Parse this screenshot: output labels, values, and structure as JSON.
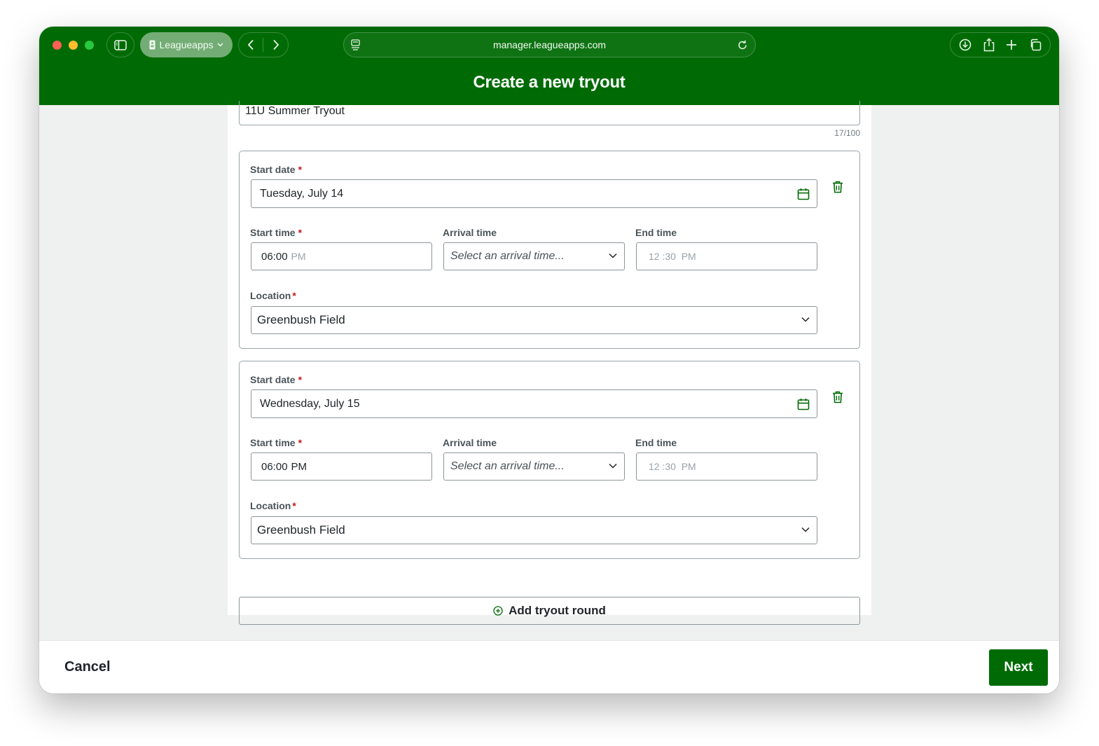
{
  "browser": {
    "profile_label": "Leagueapps",
    "url": "manager.leagueapps.com"
  },
  "page": {
    "title": "Create a new tryout"
  },
  "form": {
    "name_value": "11U Summer Tryout",
    "name_counter": "17/100",
    "rounds": [
      {
        "start_date_label": "Start date",
        "start_date_value": "Tuesday, July 14",
        "start_time_label": "Start time",
        "start_time_value": "06:00",
        "start_time_ampm": "PM",
        "arrival_time_label": "Arrival time",
        "arrival_time_placeholder": "Select an arrival time...",
        "end_time_label": "End time",
        "end_time_value": "12 :30  PM",
        "location_label": "Location",
        "location_value": "Greenbush Field"
      },
      {
        "start_date_label": "Start date",
        "start_date_value": "Wednesday, July 15",
        "start_time_label": "Start time",
        "start_time_value": "06:00",
        "start_time_ampm": "PM",
        "arrival_time_label": "Arrival time",
        "arrival_time_placeholder": "Select an arrival time...",
        "end_time_label": "End time",
        "end_time_value": "12 :30  PM",
        "location_label": "Location",
        "location_value": "Greenbush Field"
      }
    ],
    "required_mark": "*",
    "add_round_label": "Add tryout round"
  },
  "footer": {
    "cancel_label": "Cancel",
    "next_label": "Next"
  },
  "colors": {
    "brand": "#006b05",
    "required": "#c41a1a"
  },
  "icons": [
    "sidebar-icon",
    "person-icon",
    "chevron-down-icon",
    "back-icon",
    "forward-icon",
    "site-icon",
    "reload-icon",
    "download-icon",
    "share-icon",
    "plus-icon",
    "tabs-icon",
    "calendar-icon",
    "trash-icon",
    "add-circle-icon"
  ]
}
